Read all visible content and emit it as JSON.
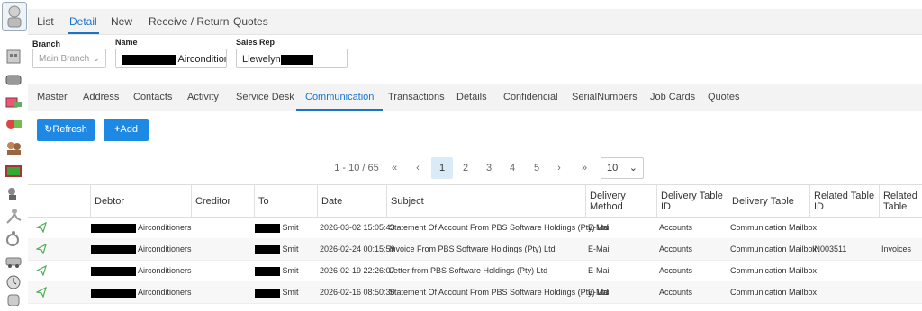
{
  "nav_tabs": [
    {
      "label": "List"
    },
    {
      "label": "Detail"
    },
    {
      "label": "New"
    },
    {
      "label": "Receive / Return"
    },
    {
      "label": "Quotes"
    }
  ],
  "fields": {
    "branch_label": "Branch",
    "branch_value": "Main Branch",
    "name_label": "Name",
    "name_suffix": "Airconditior",
    "salesrep_label": "Sales Rep",
    "salesrep_value": "Llewelyn"
  },
  "sub_tabs": [
    {
      "label": "Master"
    },
    {
      "label": "Address"
    },
    {
      "label": "Contacts"
    },
    {
      "label": "Activity"
    },
    {
      "label": "Service Desk"
    },
    {
      "label": "Communication"
    },
    {
      "label": "Transactions"
    },
    {
      "label": "Details"
    },
    {
      "label": "Confidencial"
    },
    {
      "label": "SerialNumbers"
    },
    {
      "label": "Job Cards"
    },
    {
      "label": "Quotes"
    }
  ],
  "buttons": {
    "refresh": "Refresh",
    "add": "Add"
  },
  "pager": {
    "range": "1 - 10 / 65",
    "first": "«",
    "prev": "‹",
    "pages": [
      "1",
      "2",
      "3",
      "4",
      "5"
    ],
    "next": "›",
    "last": "»",
    "page_size": "10"
  },
  "columns": [
    "Debtor",
    "Creditor",
    "To",
    "Date",
    "Subject",
    "Delivery Method",
    "Delivery Table ID",
    "Delivery Table",
    "Related Table ID",
    "Related Table"
  ],
  "rows": [
    {
      "debtor": "Airconditioners",
      "creditor": "",
      "to": "Smit",
      "date": "2026-03-02 15:05:43",
      "subject": "Statement Of Account From PBS Software Holdings (Pty) Ltd",
      "method": "E-Mail",
      "table_id": "Accounts",
      "table": "Communication Mailbox",
      "related_id": "",
      "related_table": ""
    },
    {
      "debtor": "Airconditioners",
      "creditor": "",
      "to": "Smit",
      "date": "2026-02-24 00:15:59",
      "subject": "Invoice From PBS Software Holdings (Pty) Ltd",
      "method": "E-Mail",
      "table_id": "Accounts",
      "table": "Communication Mailbox",
      "related_id": "IN003511",
      "related_table": "Invoices"
    },
    {
      "debtor": "Airconditioners",
      "creditor": "",
      "to": "Smit",
      "date": "2026-02-19 22:26:07",
      "subject": "Letter from PBS Software Holdings (Pty) Ltd",
      "method": "E-Mail",
      "table_id": "Accounts",
      "table": "Communication Mailbox",
      "related_id": "",
      "related_table": ""
    },
    {
      "debtor": "Airconditioners",
      "creditor": "",
      "to": "Smit",
      "date": "2026-02-16 08:50:30",
      "subject": "Statement Of Account From PBS Software Holdings (Pty) Ltd",
      "method": "E-Mail",
      "table_id": "Accounts",
      "table": "Communication Mailbox",
      "related_id": "",
      "related_table": ""
    }
  ],
  "colors": {
    "accent": "#1e88e5",
    "tab_active": "#1a73c8",
    "send_icon": "#4caf50"
  },
  "sidebar_icons": [
    "user-icon",
    "building-icon",
    "pills-icon",
    "pill-box-icon",
    "money-icon",
    "people-icon",
    "bundle-icon",
    "chart-icon",
    "person-icon",
    "runner-icon",
    "wheelchair-icon",
    "car-icon",
    "clock-icon",
    "hand-icon"
  ]
}
